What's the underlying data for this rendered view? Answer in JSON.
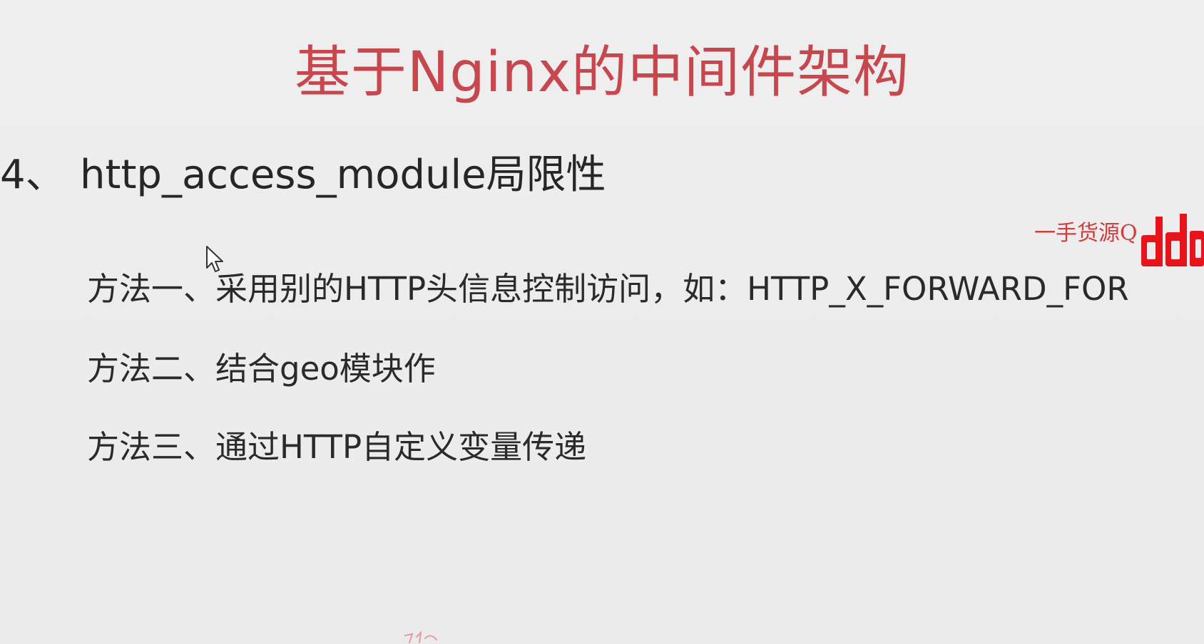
{
  "slide": {
    "title": "基于Nginx的中间件架构",
    "section": {
      "number": "4、",
      "heading": "http_access_module局限性"
    },
    "methods": [
      "方法一、采用别的HTTP头信息控制访问，如：HTTP_X_FORWARD_FOR",
      "方法二、结合geo模块作",
      "方法三、通过HTTP自定义变量传递"
    ]
  },
  "watermark": {
    "text": "一手货源Q",
    "logo": "ddd"
  },
  "colors": {
    "title": "#c7474f",
    "text": "#262626",
    "background": "#ececec",
    "watermark": "#e8141b"
  },
  "icons": {
    "cursor": "mouse-pointer-icon"
  }
}
